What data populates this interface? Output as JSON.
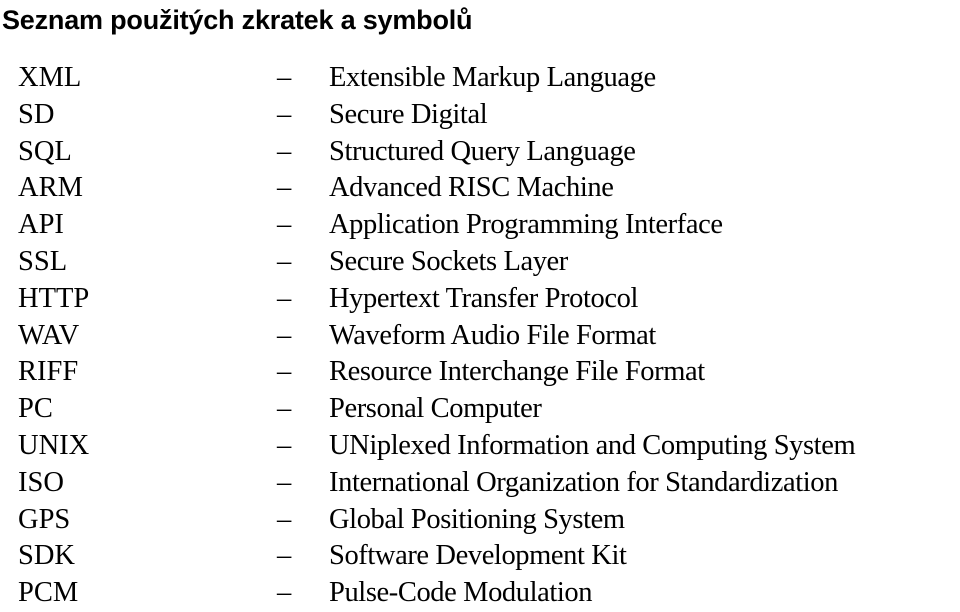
{
  "title": "Seznam použitých zkratek a symbolů",
  "separator": "–",
  "entries": [
    {
      "abbr": "XML",
      "desc": "Extensible Markup Language"
    },
    {
      "abbr": "SD",
      "desc": "Secure Digital"
    },
    {
      "abbr": "SQL",
      "desc": "Structured Query Language"
    },
    {
      "abbr": "ARM",
      "desc": "Advanced RISC Machine"
    },
    {
      "abbr": "API",
      "desc": "Application Programming Interface"
    },
    {
      "abbr": "SSL",
      "desc": "Secure Sockets Layer"
    },
    {
      "abbr": "HTTP",
      "desc": "Hypertext Transfer Protocol"
    },
    {
      "abbr": "WAV",
      "desc": "Waveform Audio File Format"
    },
    {
      "abbr": "RIFF",
      "desc": "Resource Interchange File Format"
    },
    {
      "abbr": "PC",
      "desc": "Personal Computer"
    },
    {
      "abbr": "UNIX",
      "desc": "UNiplexed Information and Computing System"
    },
    {
      "abbr": "ISO",
      "desc": "International Organization for Standardization"
    },
    {
      "abbr": "GPS",
      "desc": "Global Positioning System"
    },
    {
      "abbr": "SDK",
      "desc": "Software Development Kit"
    },
    {
      "abbr": "PCM",
      "desc": "Pulse-Code Modulation"
    }
  ]
}
